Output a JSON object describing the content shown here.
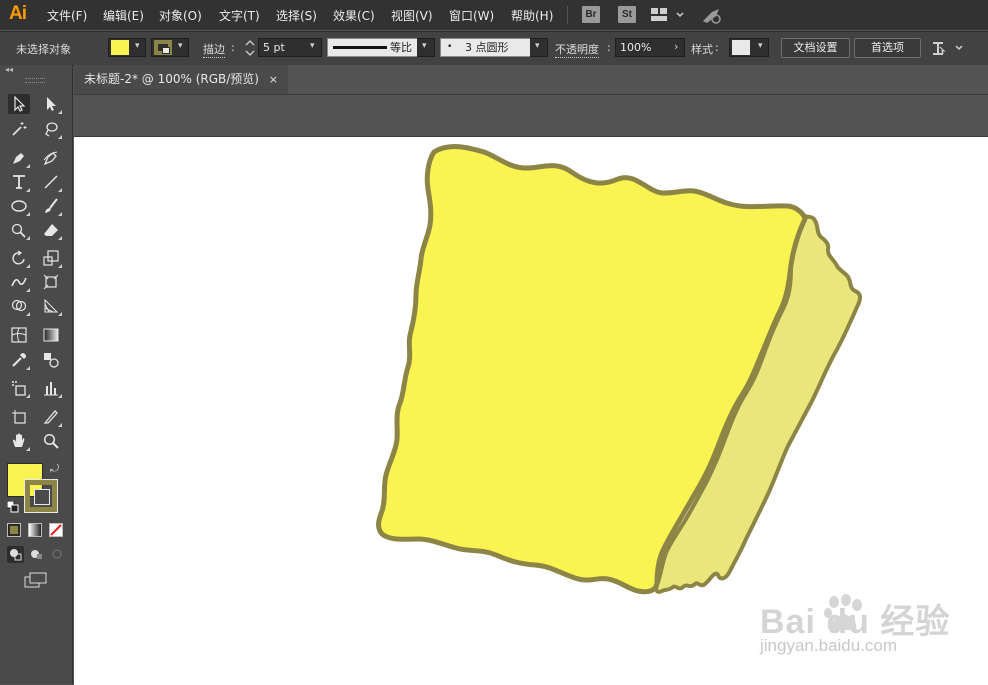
{
  "app": {
    "logo": "Ai"
  },
  "menu": {
    "items": [
      "文件(F)",
      "编辑(E)",
      "对象(O)",
      "文字(T)",
      "选择(S)",
      "效果(C)",
      "视图(V)",
      "窗口(W)",
      "帮助(H)"
    ],
    "bridge": "Br",
    "stock": "St"
  },
  "control_bar": {
    "selection_status": "未选择对象",
    "fill_color": "#f9f451",
    "stroke_color": "#8d8545",
    "stroke_label": "描边",
    "stroke_weight": "5 pt",
    "profile_label": "等比",
    "brush_label": "3 点圆形",
    "opacity_label": "不透明度",
    "opacity_value": "100%",
    "style_label": "样式",
    "doc_setup": "文档设置",
    "preferences": "首选项"
  },
  "document": {
    "tab_title": "未标题-2* @ 100% (RGB/预览)",
    "close": "×"
  },
  "artwork": {
    "main_fill": "#f9f451",
    "side_fill": "#e9e77c",
    "outline": "#8d8545"
  },
  "watermark": {
    "text": "Bai  du 经验",
    "url": "jingyan.baidu.com"
  }
}
